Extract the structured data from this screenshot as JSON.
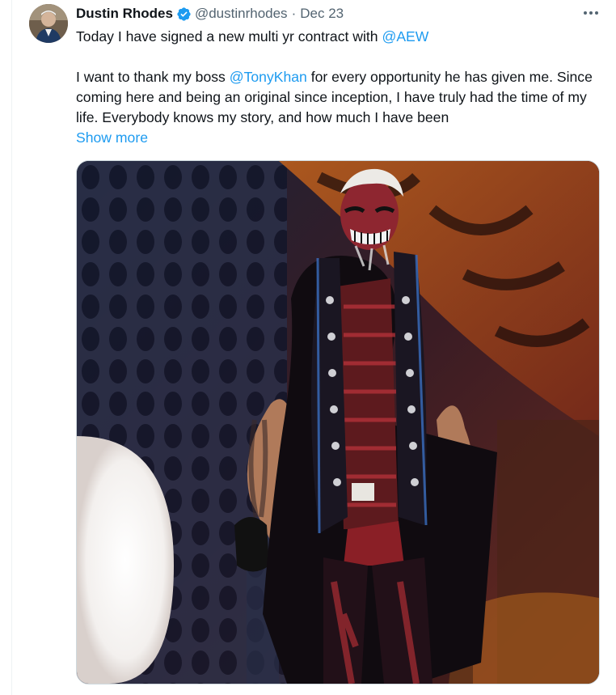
{
  "tweet": {
    "author": {
      "display_name": "Dustin Rhodes",
      "handle": "@dustinrhodes",
      "verified": true
    },
    "date": "Dec 23",
    "separator": "·",
    "text": {
      "line1_prefix": "Today I have signed a new multi yr contract with ",
      "line1_mention": "@AEW",
      "para2_prefix": "I want to thank my boss ",
      "para2_mention": "@TonyKhan",
      "para2_suffix": " for every opportunity he has given me. Since coming here and being an original since inception, I have truly had the time of my life. Everybody knows my story, and how much I have been",
      "show_more": "Show more"
    },
    "media": {
      "type": "photo",
      "description": "wrestler in black studded vest and face paint on stage"
    }
  },
  "colors": {
    "link": "#1d9bf0",
    "text": "#0f1419",
    "secondary": "#536471",
    "verified": "#1d9bf0"
  },
  "icons": {
    "verified": "verified-badge-icon",
    "more": "more-options-icon"
  }
}
